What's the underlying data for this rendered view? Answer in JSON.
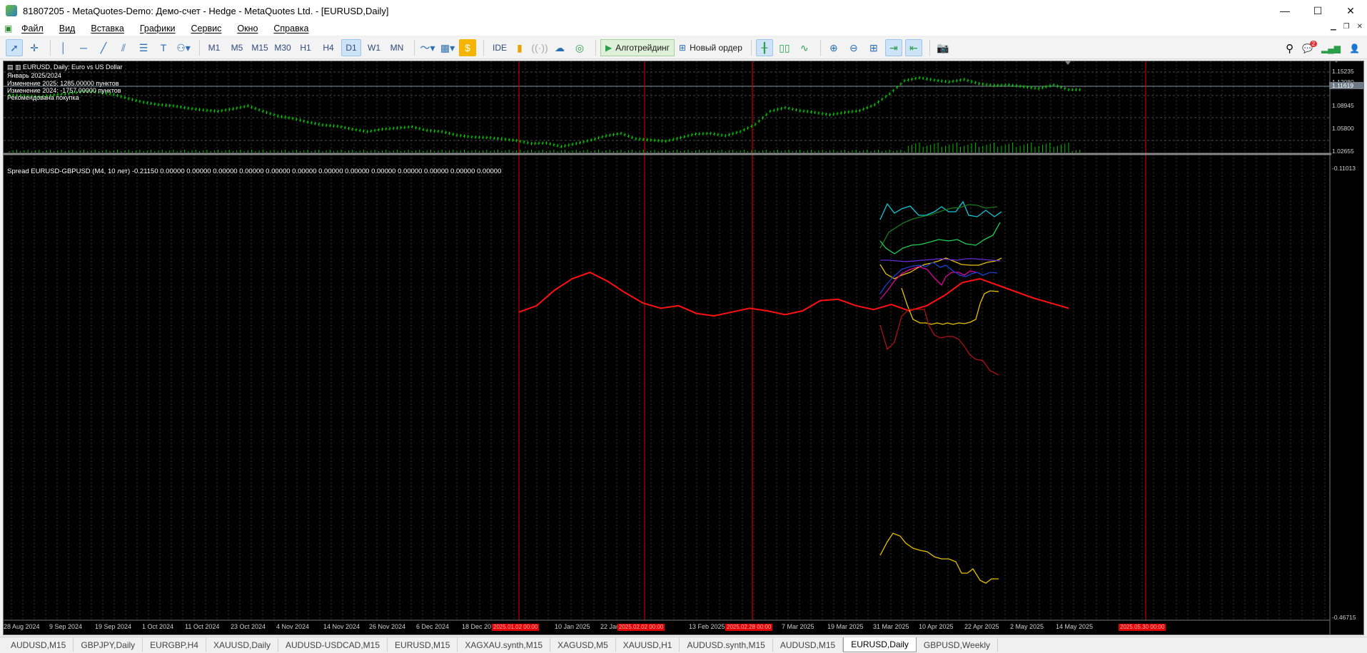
{
  "window": {
    "title": "81807205 - MetaQuotes-Demo: Демо-счет - Hedge - MetaQuotes Ltd. - [EURUSD,Daily]",
    "minimize": "—",
    "maximize": "☐",
    "close": "✕"
  },
  "menu": {
    "items": [
      "Файл",
      "Вид",
      "Вставка",
      "Графики",
      "Сервис",
      "Окно",
      "Справка"
    ]
  },
  "toolbar": {
    "timeframes": [
      "M1",
      "M5",
      "M15",
      "M30",
      "H1",
      "H4",
      "D1",
      "W1",
      "MN"
    ],
    "active_timeframe": "D1",
    "ide_label": "IDE",
    "algo_label": "Алготрейдинг",
    "new_order_label": "Новый ордер",
    "notification_count": "2"
  },
  "chart": {
    "header": "EURUSD, Daily:  Euro vs US Dollar",
    "info_lines": [
      "Январь 2025/2024",
      "Изменение 2025: 1285.00000 пунктов",
      "Изменение 2024: -1757.00000 пунктов",
      "Рекомендована покупка"
    ],
    "indicator_label": "Spread EURUSD-GBPUSD (M4, 10 лет) -0.21150 0.00000 0.00000 0.00000 0.00000 0.00000 0.00000 0.00000 0.00000 0.00000 0.00000 0.00000 0.00000 0.00000",
    "price_labels": [
      "1.15235",
      "1.12080",
      "1.11619",
      "1.08945",
      "1.05800",
      "1.02655"
    ],
    "current_price": "1.11619",
    "indicator_scale": [
      "-0.11013",
      "-0.46715"
    ],
    "date_labels": [
      "28 Aug 2024",
      "9 Sep 2024",
      "19 Sep 2024",
      "1 Oct 2024",
      "11 Oct 2024",
      "23 Oct 2024",
      "4 Nov 2024",
      "14 Nov 2024",
      "26 Nov 2024",
      "6 Dec 2024",
      "18 Dec 20",
      "10 Jan 2025",
      "22 Jan",
      "25",
      "13 Feb 2025",
      "7 Mar 2025",
      "19 Mar 2025",
      "31 Mar 2025",
      "10 Apr 2025",
      "22 Apr 2025",
      "2 May 2025",
      "14 May 2025"
    ],
    "date_markers": [
      "2025.01.02 00:00",
      "2025.02.02 00:00",
      "2025.02.28 00:00",
      "2025.05.30 00:00"
    ]
  },
  "chart_data": {
    "type": "line",
    "title": "EURUSD, Daily:  Euro vs US Dollar",
    "ylim": [
      1.015,
      1.165
    ],
    "grid": true,
    "x_range": [
      "28 Aug 2024",
      "30 May 2025"
    ],
    "series": [
      {
        "name": "EURUSD",
        "color": "#00d000",
        "values": [
          1.111,
          1.11,
          1.108,
          1.111,
          1.114,
          1.117,
          1.116,
          1.112,
          1.105,
          1.099,
          1.095,
          1.093,
          1.089,
          1.086,
          1.084,
          1.088,
          1.093,
          1.084,
          1.076,
          1.072,
          1.066,
          1.061,
          1.059,
          1.054,
          1.05,
          1.054,
          1.056,
          1.058,
          1.052,
          1.05,
          1.044,
          1.041,
          1.04,
          1.038,
          1.035,
          1.03,
          1.031,
          1.025,
          1.03,
          1.036,
          1.043,
          1.047,
          1.038,
          1.036,
          1.034,
          1.04,
          1.046,
          1.047,
          1.043,
          1.05,
          1.062,
          1.084,
          1.09,
          1.085,
          1.082,
          1.078,
          1.082,
          1.085,
          1.095,
          1.113,
          1.135,
          1.14,
          1.136,
          1.133,
          1.137,
          1.13,
          1.127,
          1.128,
          1.125,
          1.122,
          1.128,
          1.12
        ]
      }
    ],
    "indicator": {
      "name": "Spread EURUSD-GBPUSD",
      "ylim": [
        -0.46715,
        -0.11013
      ],
      "series": [
        {
          "color": "#ff1010",
          "values": [
            -0.229,
            -0.224,
            -0.212,
            -0.203,
            -0.198,
            -0.205,
            -0.214,
            -0.222,
            -0.226,
            -0.224,
            -0.23,
            -0.232,
            -0.229,
            -0.226,
            -0.228,
            -0.231,
            -0.228,
            -0.22,
            -0.219,
            -0.224,
            -0.227,
            -0.223,
            -0.228,
            -0.224,
            -0.216,
            -0.206,
            -0.203,
            -0.208,
            -0.213,
            -0.218,
            -0.222,
            -0.226
          ]
        }
      ]
    }
  }
}
